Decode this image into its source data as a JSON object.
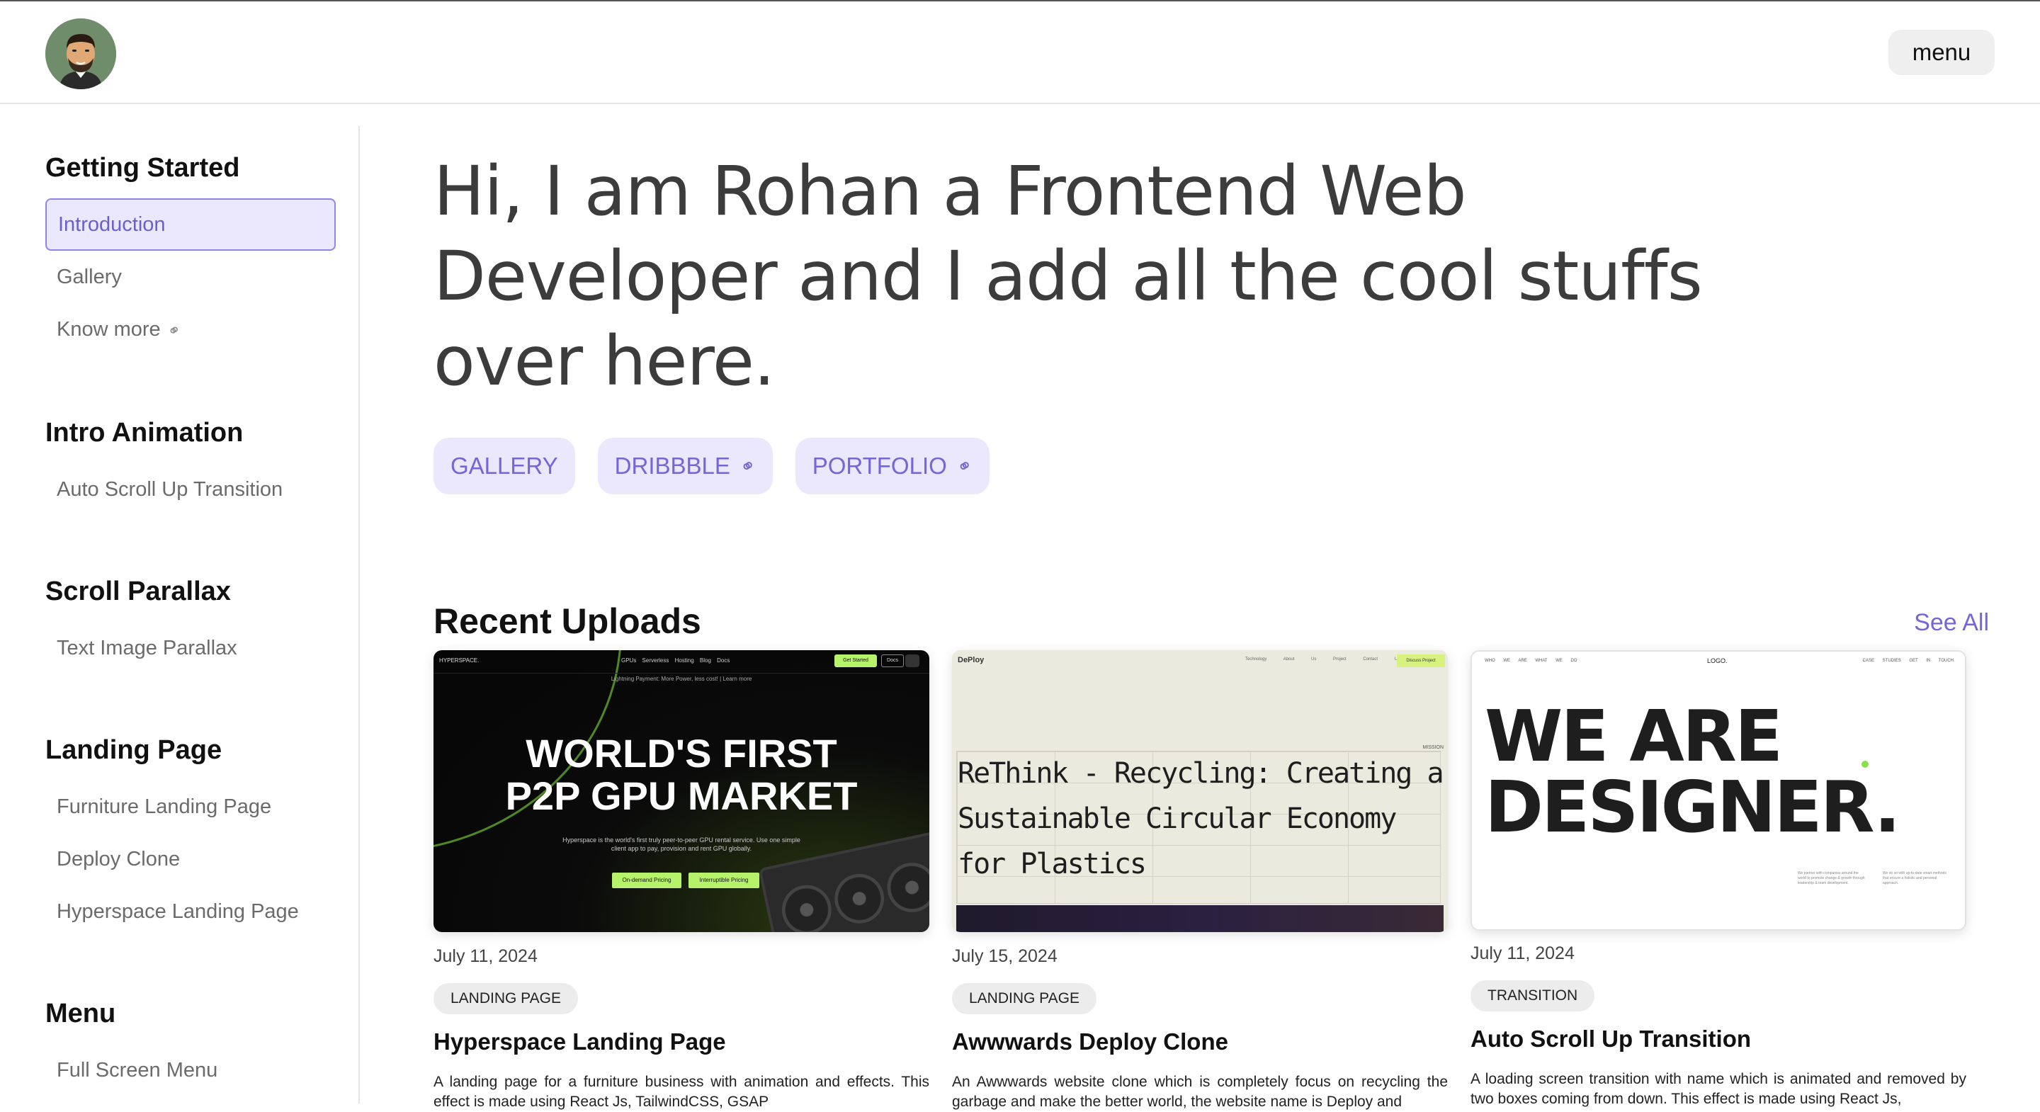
{
  "header": {
    "menu_label": "menu"
  },
  "sidebar": {
    "sections": [
      {
        "title": "Getting Started",
        "items": [
          "Introduction",
          "Gallery",
          "Know more"
        ]
      },
      {
        "title": "Intro Animation",
        "items": [
          "Auto Scroll Up Transition"
        ]
      },
      {
        "title": "Scroll Parallax",
        "items": [
          "Text Image Parallax"
        ]
      },
      {
        "title": "Landing Page",
        "items": [
          "Furniture Landing Page",
          "Deploy Clone",
          "Hyperspace Landing Page"
        ]
      },
      {
        "title": "Menu",
        "items": [
          "Full Screen Menu"
        ]
      }
    ],
    "active_item": "Introduction"
  },
  "hero": {
    "line1": "Hi, I am Rohan a Frontend Web",
    "line2": "Developer and I add all the cool stuffs",
    "line3": "over here."
  },
  "tags": [
    "GALLERY",
    "DRIBBBLE",
    "PORTFOLIO"
  ],
  "recent": {
    "title": "Recent Uploads",
    "see_all": "See All",
    "cards": [
      {
        "date": "July 11, 2024",
        "category": "LANDING PAGE",
        "title": "Hyperspace Landing Page",
        "description": "A landing page for a furniture business with animation and effects. This effect is made using React Js, TailwindCSS, GSAP",
        "thumb": {
          "logo": "HYPERSPACE.",
          "nav_links": "GPUs Serverless Hosting Blog Docs",
          "get_started": "Get Started",
          "docs": "Docs",
          "promo": "Lightning Payment: More Power, less cost! | Learn more",
          "headline1": "WORLD'S FIRST",
          "headline2": "P2P GPU MARKET",
          "subtext": "Hyperspace is the world's first truly peer-to-peer GPU rental service. Use one simple client app to pay, provision and rent GPU globally.",
          "button1": "On-demand Pricing",
          "button2": "Interruptible Pricing"
        }
      },
      {
        "date": "July 15, 2024",
        "category": "LANDING PAGE",
        "title": "Awwwards Deploy Clone",
        "description": "An Awwwards website clone which is completely focus on recycling the garbage and make the better world, the website name is Deploy and",
        "thumb": {
          "logo": "DePloy",
          "nav_links": "Technology About Us Project Contact Us",
          "cta": "Discuss Project",
          "mission": "MISSION",
          "headline": "ReThink - Recycling: Creating a Sustainable Circular Economy for Plastics"
        }
      },
      {
        "date": "July 11, 2024",
        "category": "TRANSITION",
        "title": "Auto Scroll Up Transition",
        "description": "A loading screen transition with name which is animated and removed by two boxes coming from down. This effect is made using React Js,",
        "thumb": {
          "nav_left": "WHO WE ARE WHAT WE DO",
          "logo": "LOGO.",
          "nav_right": "CASE STUDIES GET IN TOUCH",
          "headline1": "WE ARE",
          "headline2": "DESIGNER.",
          "small1": "We partner with companies around the world to promote change & growth through leadership & team development.",
          "small2": "We do so with up-to-date smart methods that ensure a holistic and personal approach."
        }
      }
    ]
  },
  "colors": {
    "accent": "#7465d8",
    "accent_bg": "#ebe8fd",
    "brand_green": "#b6f36a"
  },
  "icons": {
    "external_link": "link-icon"
  }
}
